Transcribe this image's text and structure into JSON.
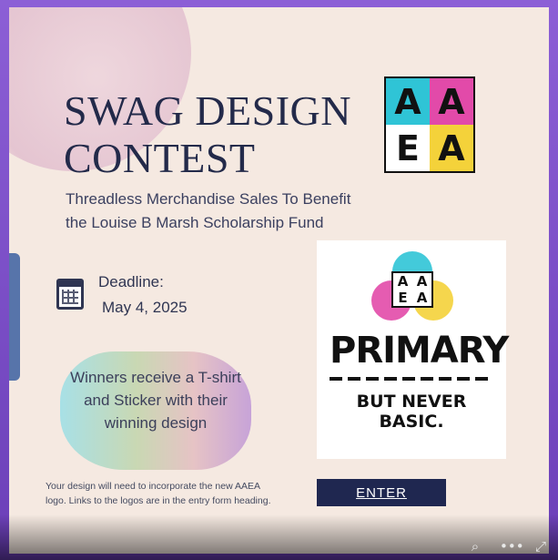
{
  "poster": {
    "title_line1": "SWAG DESIGN",
    "title_line2": "CONTEST",
    "subtitle": "Threadless Merchandise Sales To Benefit the Louise B Marsh Scholarship Fund",
    "deadline_label": "Deadline:",
    "deadline_date": "May 4, 2025",
    "prize_text": "Winners receive a T-shirt and Sticker with their winning design",
    "footnote": "Your design will need to incorporate the new AAEA logo. Links to the logos are in the entry form heading.",
    "enter_label": "ENTER"
  },
  "logo": {
    "letters": [
      "A",
      "A",
      "E",
      "A"
    ],
    "colors": [
      "#2fc4d6",
      "#e24aa9",
      "#ffffff",
      "#f4d23a"
    ]
  },
  "primary_card": {
    "headline": "PRIMARY",
    "tagline": "BUT NEVER BASIC.",
    "letters": [
      "A",
      "A",
      "E",
      "A"
    ]
  },
  "toolbar": {
    "zoom_icon": "⌕",
    "more_icon": "•••",
    "expand_icon": "⤢"
  }
}
